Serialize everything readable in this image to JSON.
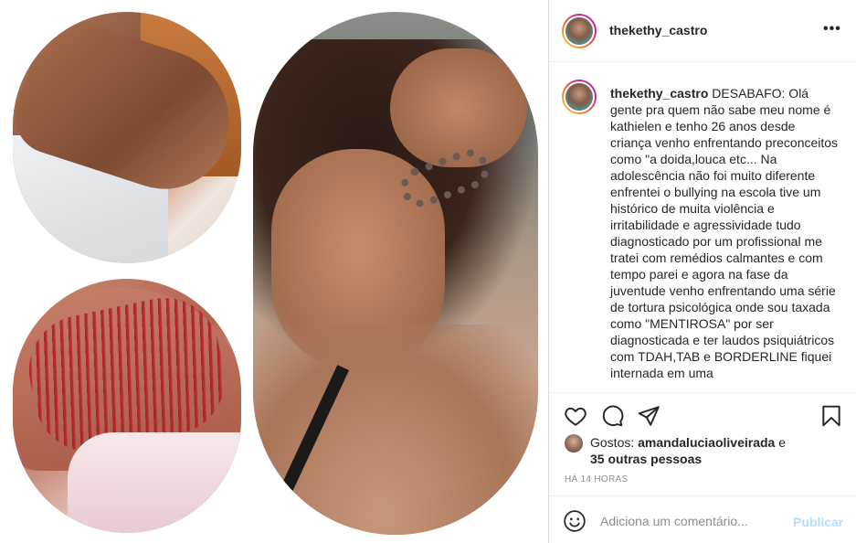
{
  "post": {
    "author": "thekethy_castro",
    "more_icon": "more-horizontal-icon",
    "caption": {
      "username": "thekethy_castro",
      "text": "DESABAFO: Olá gente pra quem não sabe meu nome é kathielen e tenho 26 anos desde criança venho enfrentando preconceitos como \"a doida,louca etc... Na adolescência não foi muito diferente enfrentei o bullying na escola tive um histórico de muita violência e irritabilidade e agressividade tudo diagnosticado por um profissional me tratei com remédios calmantes e com tempo parei e agora na fase da juventude venho enfrentando uma série de tortura psicológica onde sou taxada como \"MENTIROSA\" por ser diagnosticada e ter laudos psiquiátricos com TDAH,TAB e BORDERLINE fiquei internada em uma"
    },
    "actions": {
      "like_icon": "heart-icon",
      "comment_icon": "comment-icon",
      "share_icon": "paper-plane-icon",
      "save_icon": "bookmark-icon"
    },
    "likes": {
      "prefix": "Gostos: ",
      "first_liker": "amandaluciaoliveirada",
      "joiner": " e",
      "others": "35 outras pessoas"
    },
    "timestamp": "HÁ 14 HORAS",
    "comment_box": {
      "emoji_icon": "smiley-icon",
      "placeholder": "Adiciona um comentário...",
      "publish_label": "Publicar"
    }
  },
  "colors": {
    "text": "#262626",
    "muted": "#8e8e8e",
    "publish_disabled": "#b2dffc",
    "border": "#efefef"
  }
}
